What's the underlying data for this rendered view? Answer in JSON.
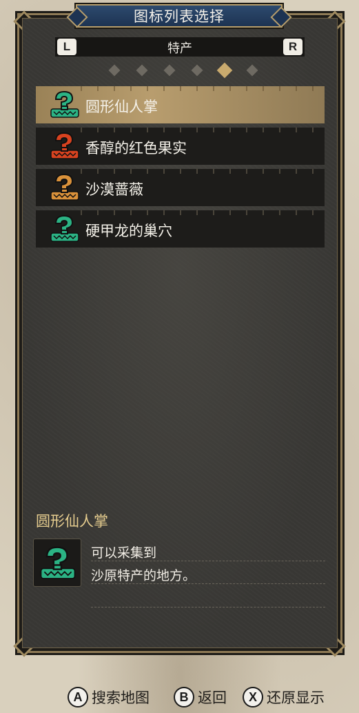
{
  "header": {
    "title": "图标列表选择"
  },
  "category": {
    "left_shoulder": "L",
    "right_shoulder": "R",
    "label": "特产",
    "page_count": 6,
    "active_page": 5
  },
  "list": {
    "items": [
      {
        "label": "圆形仙人掌",
        "icon": "question-mark-mushroom-icon",
        "color": "#2bb384",
        "selected": true
      },
      {
        "label": "香醇的红色果实",
        "icon": "question-mark-mushroom-icon",
        "color": "#d8421f",
        "selected": false
      },
      {
        "label": "沙漠蔷薇",
        "icon": "question-mark-mushroom-icon",
        "color": "#d9913a",
        "selected": false
      },
      {
        "label": "硬甲龙的巢穴",
        "icon": "question-mark-mushroom-icon",
        "color": "#2bb384",
        "selected": false
      }
    ]
  },
  "detail": {
    "title": "圆形仙人掌",
    "icon": "question-mark-mushroom-icon",
    "icon_color": "#2bb384",
    "line1": "可以采集到",
    "line2": "沙原特产的地方。"
  },
  "footer": {
    "buttons": [
      {
        "glyph": "A",
        "label": "搜索地图"
      },
      {
        "glyph": "B",
        "label": "返回"
      },
      {
        "glyph": "X",
        "label": "还原显示"
      }
    ]
  },
  "colors": {
    "accent_gold": "#c9aa6e",
    "title_blue": "#1d3352",
    "panel_dark": "#383734"
  }
}
